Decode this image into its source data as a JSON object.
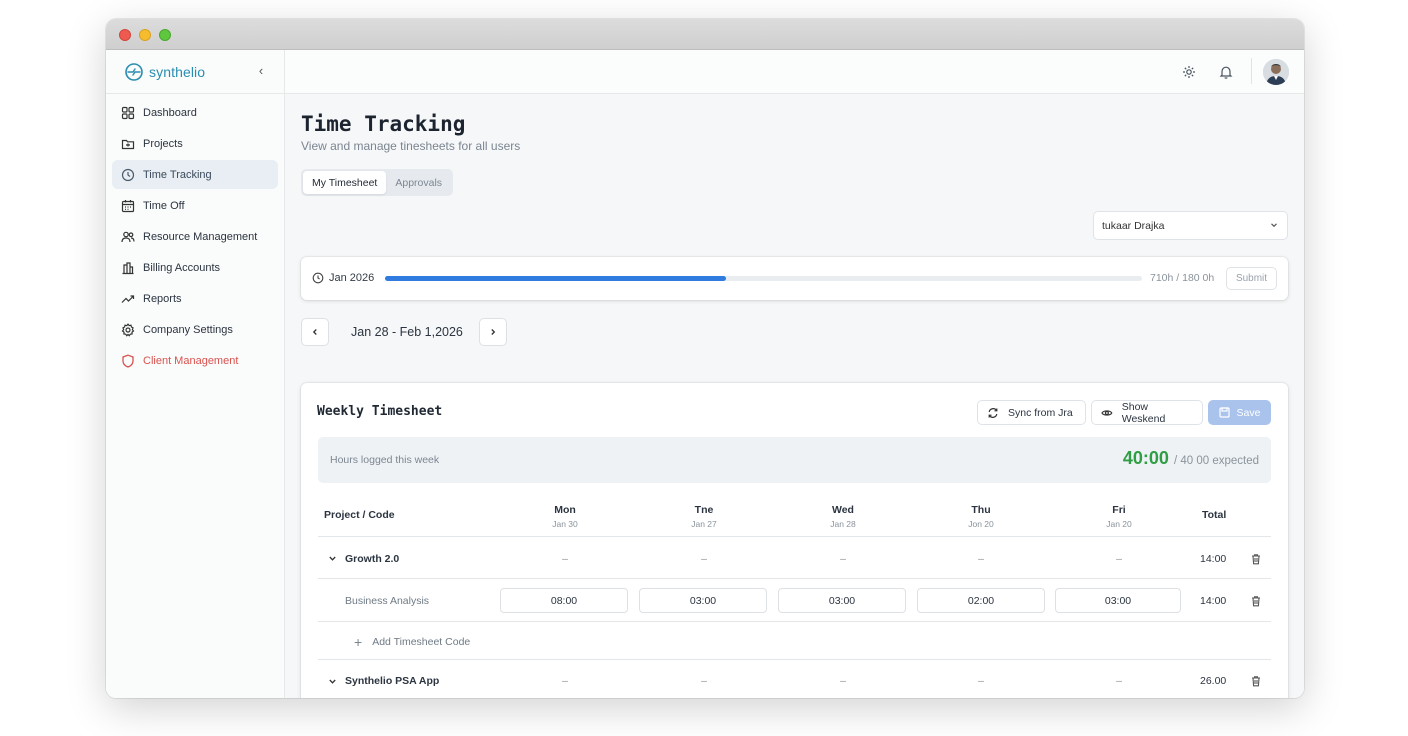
{
  "brand": {
    "name": "synthelio"
  },
  "sidebar": {
    "items": [
      {
        "label": "Dashboard",
        "icon": "dashboard-icon"
      },
      {
        "label": "Projects",
        "icon": "folder-icon"
      },
      {
        "label": "Time Tracking",
        "icon": "clock-icon",
        "active": true
      },
      {
        "label": "Time Off",
        "icon": "calendar-icon"
      },
      {
        "label": "Resource Management",
        "icon": "users-icon"
      },
      {
        "label": "Billing Accounts",
        "icon": "building-icon"
      },
      {
        "label": "Reports",
        "icon": "trend-icon"
      },
      {
        "label": "Company Settings",
        "icon": "gear-icon"
      },
      {
        "label": "Client Management",
        "icon": "shield-icon",
        "danger": true
      }
    ]
  },
  "topbar": {
    "icons": [
      "sun-icon",
      "bell-icon",
      "avatar"
    ]
  },
  "page": {
    "title": "Time Tracking",
    "subtitle": "View and manage tinesheets for all users",
    "tabs": [
      "My Timesheet",
      "Approvals"
    ]
  },
  "user_select": {
    "value": "tukaar Drajka"
  },
  "period": {
    "label": "Jan 2026",
    "progress_fraction": 0.45,
    "hours_text": "710h / 180 0h",
    "submit_label": "Submit"
  },
  "week": {
    "range": "Jan 28 - Feb 1,2026"
  },
  "timesheet": {
    "title": "Weekly Timesheet",
    "sync_label": "Sync from Jra",
    "weekend_label": "Show Weskend",
    "save_label": "Save",
    "summary_label": "Hours logged this week",
    "logged": "40:00",
    "expected": "/ 40 00 expected",
    "columns": {
      "project": "Project / Code",
      "total": "Total",
      "days": [
        {
          "day": "Mon",
          "date": "Jan 30"
        },
        {
          "day": "Tne",
          "date": "Jan 27"
        },
        {
          "day": "Wed",
          "date": "Jan 28"
        },
        {
          "day": "Thu",
          "date": "Jon 20"
        },
        {
          "day": "Fri",
          "date": "Jan 20"
        }
      ]
    },
    "rows": {
      "growth": {
        "name": "Growth 2.0",
        "cells": [
          "–",
          "–",
          "–",
          "–",
          "–"
        ],
        "total": "14:00"
      },
      "business": {
        "name": "Business Analysis",
        "hours": [
          "08:00",
          "03:00",
          "03:00",
          "02:00",
          "03:00"
        ],
        "total": "14:00"
      },
      "add_code": "Add Timesheet Code",
      "psa": {
        "name": "Synthelio PSA App",
        "cells": [
          "–",
          "–",
          "–",
          "–",
          "–"
        ],
        "total": "26.00"
      }
    }
  },
  "colors": {
    "accent": "#2f7be0",
    "brand": "#2a8db0",
    "success": "#2f9e44",
    "danger": "#d9534f"
  }
}
